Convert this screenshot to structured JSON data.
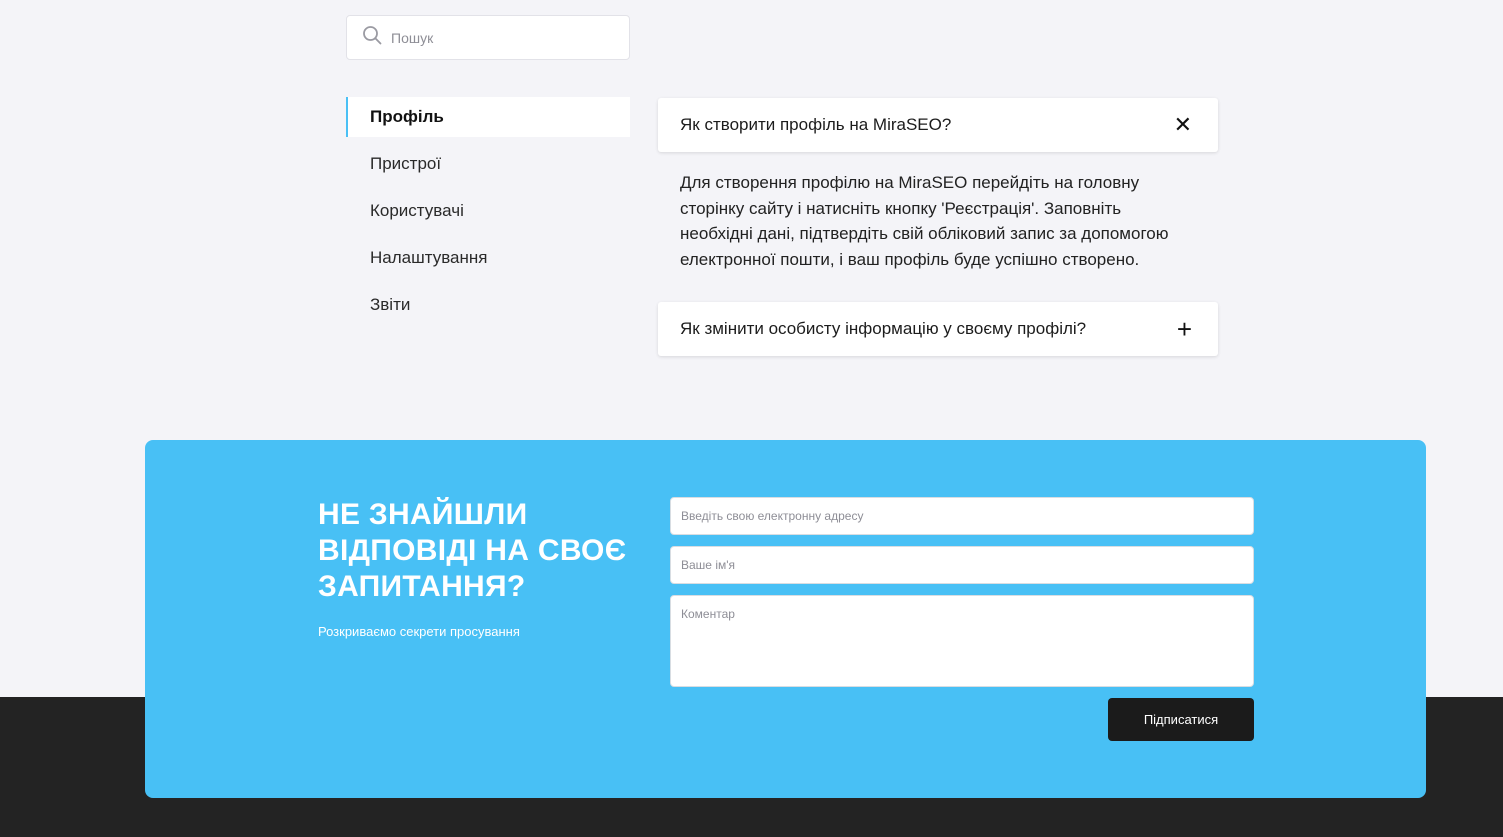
{
  "search": {
    "placeholder": "Пошук",
    "icon": "search-icon"
  },
  "sidebar": {
    "items": [
      {
        "label": "Профіль",
        "active": true
      },
      {
        "label": "Пристрої"
      },
      {
        "label": "Користувачі"
      },
      {
        "label": "Налаштування"
      },
      {
        "label": "Звіти"
      }
    ]
  },
  "faq": {
    "items": [
      {
        "question": "Як створити профіль на MiraSEO?",
        "answer": "Для створення профілю на MiraSEO перейдіть на головну сторінку сайту і натисніть кнопку 'Реєстрація'. Заповніть необхідні дані, підтвердіть свій обліковий запис за допомогою електронної пошти, і ваш профіль буде успішно створено.",
        "expanded": true,
        "icon_glyph": "✕"
      },
      {
        "question": "Як змінити особисту інформацію у своєму профілі?",
        "expanded": false,
        "icon_glyph": "+"
      }
    ]
  },
  "cta": {
    "title": "НЕ ЗНАЙШЛИ ВІДПОВІДІ НА СВОЄ ЗАПИТАННЯ?",
    "subtitle": "Розкриваємо секрети просування",
    "email_placeholder": "Введіть свою електронну адресу",
    "name_placeholder": "Ваше ім'я",
    "comment_placeholder": "Коментар",
    "submit_label": "Підписатися"
  },
  "colors": {
    "accent": "#48c0f5",
    "page_bg": "#f4f4f8",
    "footer_bg": "#232323",
    "button_bg": "#1b1b1b"
  }
}
